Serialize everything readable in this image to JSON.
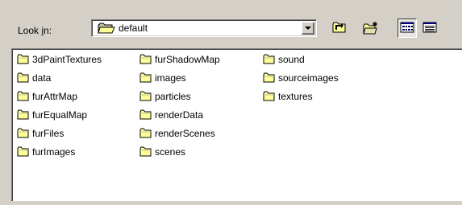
{
  "look_in": {
    "label_prefix": "Look ",
    "label_hotkey": "i",
    "label_suffix": "n:",
    "current_folder": "default"
  },
  "toolbar": {
    "up_folder_icon": "folder-up-icon",
    "new_folder_icon": "new-folder-icon",
    "list_view_icon": "list-view-icon",
    "details_view_icon": "details-view-icon",
    "active_view": "list"
  },
  "files": {
    "columns": [
      [
        "3dPaintTextures",
        "data",
        "furAttrMap",
        "furEqualMap",
        "furFiles",
        "furImages"
      ],
      [
        "furShadowMap",
        "images",
        "particles",
        "renderData",
        "renderScenes",
        "scenes"
      ],
      [
        "sound",
        "sourceimages",
        "textures"
      ]
    ]
  },
  "colors": {
    "window_bg": "#d4d0c8",
    "folder_fill": "#ffff99",
    "folder_shade": "#c0c0a0"
  }
}
